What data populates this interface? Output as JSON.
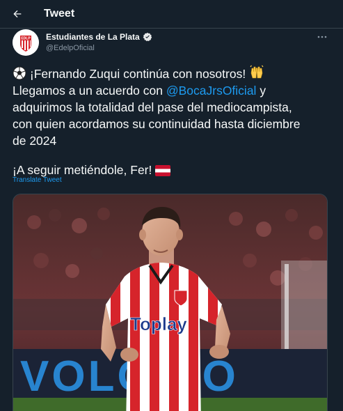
{
  "header": {
    "title": "Tweet"
  },
  "author": {
    "name": "Estudiantes de La Plata",
    "handle": "@EdelpOficial",
    "avatar_text": "EDLP"
  },
  "tweet": {
    "line1": "¡Fernando Zuqui continúa con nosotros!",
    "line2_pre": "Llegamos a un acuerdo con ",
    "mention": "@BocaJrsOficial",
    "line2_post": " y",
    "line3": "adquirimos la totalidad del pase del mediocampista,",
    "line4": "con quien acordamos su continuidad hasta diciembre",
    "line5": "de 2024",
    "line6": "¡A seguir metiéndole, Fer!"
  },
  "translate_label": "Translate Tweet",
  "media": {
    "shirt_sponsor": "Toplay",
    "banner_text": "VOLQUIO"
  },
  "colors": {
    "background": "#15202b",
    "link": "#1d9bf0",
    "secondary": "#8b98a5",
    "brand_red": "#d6242b"
  },
  "icons": [
    "back-arrow-icon",
    "verified-icon",
    "more-icon",
    "soccer-ball-emoji",
    "raised-hands-emoji",
    "flag-emoji"
  ]
}
